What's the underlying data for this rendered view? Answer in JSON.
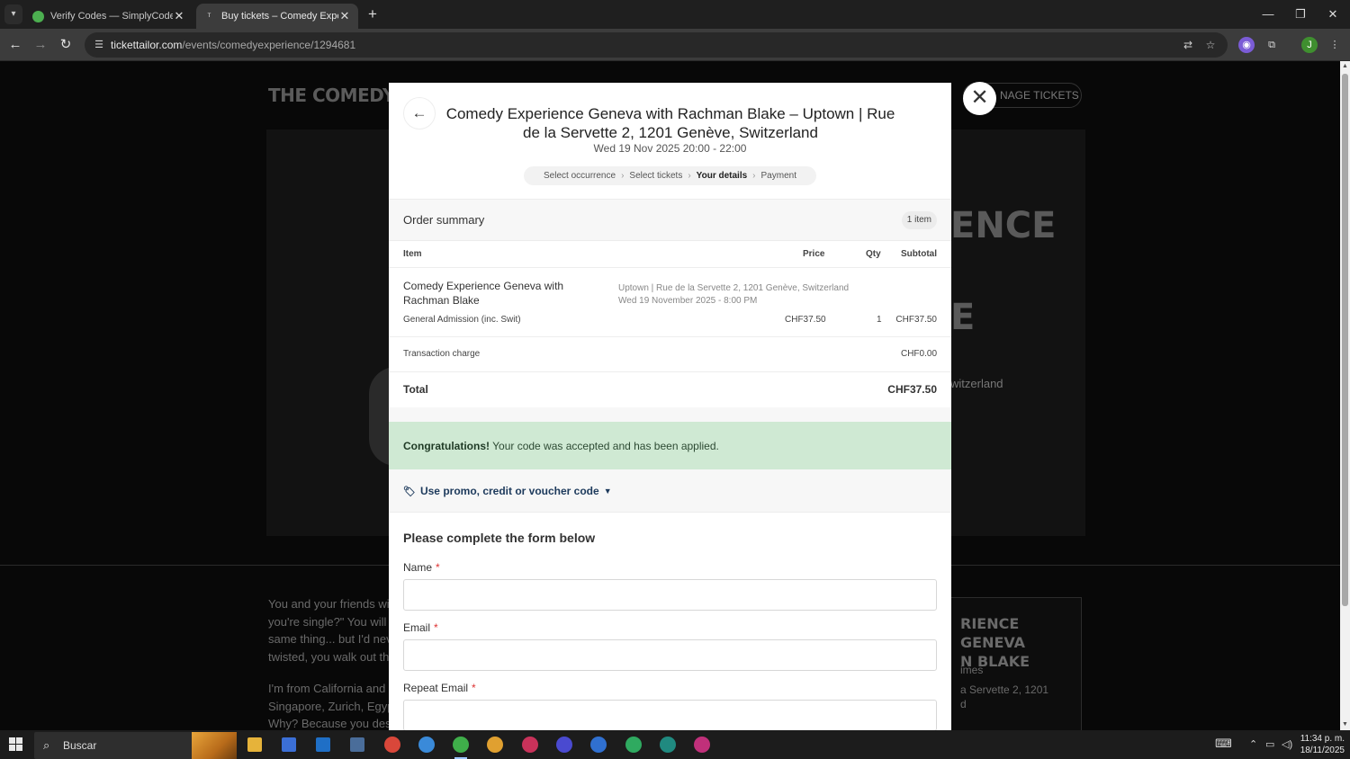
{
  "browser": {
    "tabs": [
      {
        "title": "Verify Codes — SimplyCodes",
        "active": false
      },
      {
        "title": "Buy tickets – Comedy Experience",
        "active": true
      }
    ],
    "url_host": "tickettailor.com",
    "url_path": "/events/comedyexperience/1294681",
    "profile_initial": "J"
  },
  "background_page": {
    "logo": "THE COMEDY EX",
    "manage_tickets": "NAGE TICKETS",
    "hero_word_1": "ENCE",
    "hero_word_2": "E",
    "hero_city": "witzerland",
    "desc_lines": [
      "You and your friends wi",
      "you're single?\" You will",
      "same thing... but I'd nev",
      "twisted, you walk out thi",
      "",
      "I'm from California and I",
      "Singapore, Zurich, Egyp",
      "Why? Because you dese"
    ],
    "card_title_1": "RIENCE GENEVA",
    "card_title_2": "N BLAKE",
    "card_line_1": "imes",
    "card_line_2": "a Servette 2, 1201",
    "card_line_3": "d"
  },
  "modal": {
    "event_title": "Comedy Experience Geneva with Rachman Blake – Uptown | Rue de la Servette 2, 1201 Genève, Switzerland",
    "event_date": "Wed 19 Nov 2025 20:00 - 22:00",
    "steps": [
      "Select occurrence",
      "Select tickets",
      "Your details",
      "Payment"
    ],
    "order_summary": {
      "title": "Order summary",
      "badge": "1 item",
      "headers": {
        "item": "Item",
        "price": "Price",
        "qty": "Qty",
        "subtotal": "Subtotal"
      },
      "item_name": "Comedy Experience Geneva with Rachman Blake",
      "item_location": "Uptown | Rue de la Servette 2, 1201 Genève, Switzerland",
      "item_datetime": "Wed 19 November 2025 - 8:00 PM",
      "ticket_type": "General Admission (inc. Swit)",
      "ticket_price": "CHF37.50",
      "ticket_qty": "1",
      "ticket_subtotal": "CHF37.50",
      "transaction_label": "Transaction charge",
      "transaction_value": "CHF0.00",
      "total_label": "Total",
      "total_value": "CHF37.50"
    },
    "success": {
      "bold": "Congratulations!",
      "text": " Your code was accepted and has been applied."
    },
    "promo_link": "Use promo, credit or voucher code",
    "form": {
      "title": "Please complete the form below",
      "name_label": "Name",
      "email_label": "Email",
      "repeat_email_label": "Repeat Email",
      "required_mark": "*",
      "name_value": "",
      "email_value": "",
      "repeat_email_value": ""
    }
  },
  "taskbar": {
    "search_placeholder": "Buscar",
    "time": "11:34 p. m.",
    "date": "18/11/2025"
  },
  "colors": {
    "success_bg": "#cfe9d3",
    "promo_link": "#1d3a5c",
    "required": "#d33"
  }
}
